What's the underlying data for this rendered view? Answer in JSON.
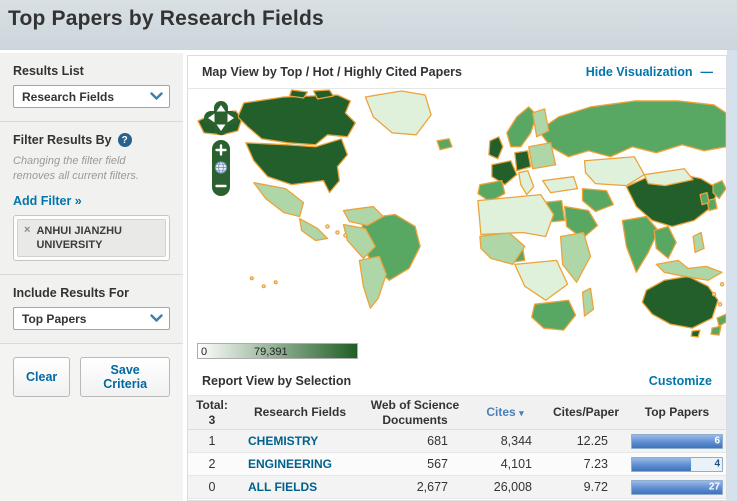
{
  "page": {
    "title": "Top Papers by Research Fields"
  },
  "sidebar": {
    "results_list": {
      "label": "Results List",
      "value": "Research Fields"
    },
    "filter": {
      "label": "Filter Results By",
      "help_glyph": "?",
      "note": "Changing the filter field removes all current filters.",
      "add_filter": "Add Filter »",
      "chip": {
        "remove_glyph": "×",
        "label": "ANHUI JIANZHU UNIVERSITY"
      }
    },
    "include": {
      "label": "Include Results For",
      "value": "Top Papers"
    },
    "actions": {
      "clear": "Clear",
      "save": "Save Criteria"
    }
  },
  "map": {
    "header": "Map View by Top / Hot / Highly Cited Papers",
    "hide_link": "Hide Visualization",
    "hide_glyph": "—",
    "controls": {
      "zoom_in": "+",
      "zoom_out": "−"
    },
    "legend": {
      "min": "0",
      "max": "79,391",
      "start_color": "#ffffff",
      "end_color": "#1e5e24"
    },
    "palette": {
      "dark": "#235f2b",
      "medium": "#58a763",
      "light": "#aed6a7",
      "pale": "#e0f1db",
      "border": "#eda339"
    }
  },
  "report": {
    "header": "Report View by Selection",
    "customize": "Customize",
    "table": {
      "total_label": "Total:",
      "total_value": "3",
      "col_field": "Research Fields",
      "col_docs": "Web of Science Documents",
      "col_cites": "Cites",
      "sort_glyph": "▾",
      "col_cpp": "Cites/Paper",
      "col_top": "Top Papers",
      "rows": [
        {
          "rank": "1",
          "field": "CHEMISTRY",
          "documents": "681",
          "cites": "8,344",
          "cites_per_paper": "12.25",
          "top_papers": "6",
          "bar_percent": 100,
          "bar_full": "true"
        },
        {
          "rank": "2",
          "field": "ENGINEERING",
          "documents": "567",
          "cites": "4,101",
          "cites_per_paper": "7.23",
          "top_papers": "4",
          "bar_percent": 66,
          "bar_full": "false"
        },
        {
          "rank": "0",
          "field": "ALL FIELDS",
          "documents": "2,677",
          "cites": "26,008",
          "cites_per_paper": "9.72",
          "top_papers": "27",
          "bar_percent": 100,
          "bar_full": "true"
        }
      ]
    }
  }
}
